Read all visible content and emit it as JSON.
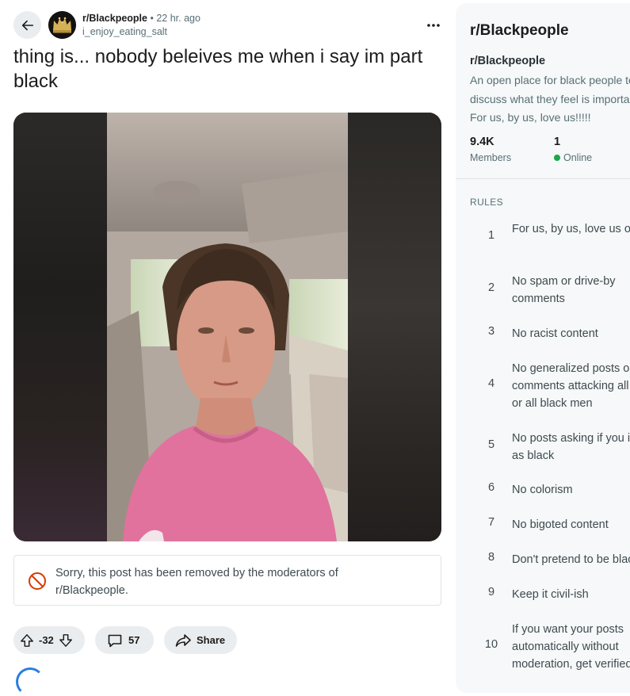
{
  "post": {
    "subreddit": "r/Blackpeople",
    "separator": "•",
    "time_ago": "22 hr. ago",
    "author": "i_enjoy_eating_salt",
    "title": "thing is... nobody beleives me when i say im part black",
    "removed_notice": "Sorry, this post has been removed by the moderators of r/Blackpeople.",
    "score": "-32",
    "comment_count": "57",
    "share_label": "Share",
    "icons": {
      "back": "back-arrow-icon",
      "more": "more-options-icon",
      "ban": "ban-icon",
      "upvote": "upvote-arrow-icon",
      "downvote": "downvote-arrow-icon",
      "comment": "comment-bubble-icon",
      "share": "share-arrow-icon"
    }
  },
  "sidebar": {
    "title": "r/Blackpeople",
    "name": "r/Blackpeople",
    "description": "An open place for black people to discuss what they feel is important. For us, by us, love us!!!!!",
    "members_count": "9.4K",
    "members_label": "Members",
    "online_count": "1",
    "online_label": "Online",
    "rules_heading": "RULES",
    "rules": [
      {
        "num": "1",
        "text": "For us, by us, love us only"
      },
      {
        "num": "2",
        "text": "No spam or drive-by comments"
      },
      {
        "num": "3",
        "text": "No racist content"
      },
      {
        "num": "4",
        "text": "No generalized posts or comments attacking all women or all black men"
      },
      {
        "num": "5",
        "text": "No posts asking if you identify as black"
      },
      {
        "num": "6",
        "text": "No colorism"
      },
      {
        "num": "7",
        "text": "No bigoted content"
      },
      {
        "num": "8",
        "text": "Don't pretend to be black"
      },
      {
        "num": "9",
        "text": "Keep it civil-ish"
      },
      {
        "num": "10",
        "text": "If you want your posts automatically without moderation, get verified"
      }
    ]
  },
  "colors": {
    "accent_online": "#1ba84a",
    "ban_red": "#d93a00",
    "muted_text": "#576f76",
    "pill_bg": "#eaedef"
  }
}
